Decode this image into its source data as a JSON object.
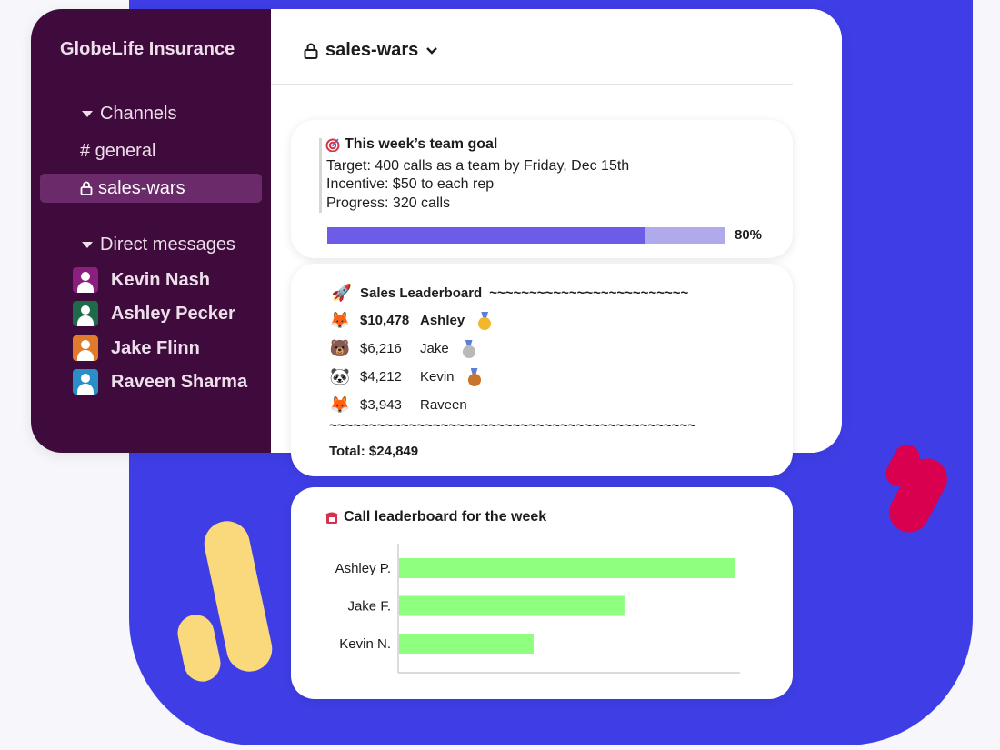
{
  "workspace": {
    "name": "GlobeLife Insurance"
  },
  "sidebar": {
    "channels_label": "Channels",
    "channels": [
      {
        "label": "# general"
      },
      {
        "label": "sales-wars"
      }
    ],
    "dm_label": "Direct messages",
    "dms": [
      {
        "name": "Kevin Nash",
        "color": "#8a1f7f"
      },
      {
        "name": "Ashley Pecker",
        "color": "#1e6b4a"
      },
      {
        "name": "Jake Flinn",
        "color": "#e07a2c"
      },
      {
        "name": "Raveen Sharma",
        "color": "#2a8fc7"
      }
    ]
  },
  "channel_header": {
    "name": "sales-wars"
  },
  "goal_card": {
    "icon": "target-icon",
    "title": "This week’s team goal",
    "target": "Target: 400 calls as a team by Friday, Dec 15th",
    "incentive": "Incentive: $50 to each rep",
    "progress_text": "Progress: 320 calls",
    "progress_fraction": 0.8,
    "progress_label": "80%",
    "bar_color": "#6c5ce7",
    "track_color": "#b0a9ec"
  },
  "leaderboard_card": {
    "title_icon": "rocket-icon",
    "title": "Sales Leaderboard",
    "title_tilde": "~~~~~~~~~~~~~~~~~~~~~~~~~",
    "rows": [
      {
        "icon": "fox-icon",
        "amount": "$10,478",
        "name": "Ashley",
        "medal": "gold-medal-icon",
        "bold": true
      },
      {
        "icon": "bear-icon",
        "amount": "$6,216",
        "name": "Jake",
        "medal": "silver-medal-icon",
        "bold": false
      },
      {
        "icon": "panda-icon",
        "amount": "$4,212",
        "name": "Kevin",
        "medal": "bronze-medal-icon",
        "bold": false
      },
      {
        "icon": "fox-icon",
        "amount": "$3,943",
        "name": "Raveen",
        "medal": "",
        "bold": false
      }
    ],
    "divider": "~~~~~~~~~~~~~~~~~~~~~~~~~~~~~~~~~~~~~~~~~~~~~~",
    "total": "Total: $24,849"
  },
  "calls_card": {
    "title_icon": "telephone-icon",
    "title": "Call leaderboard for the week",
    "chart_data": {
      "type": "bar",
      "orientation": "horizontal",
      "categories": [
        "Ashley P.",
        "Jake F.",
        "Kevin N."
      ],
      "values": [
        100,
        67,
        40
      ],
      "bar_color": "#8fff7f",
      "grid": false
    }
  },
  "colors": {
    "sidebar": "#3f0b3d",
    "active_channel": "#6b2b6a",
    "backdrop": "#3f3ee6",
    "accent_yellow": "#fad87c",
    "accent_red": "#d9004f"
  }
}
